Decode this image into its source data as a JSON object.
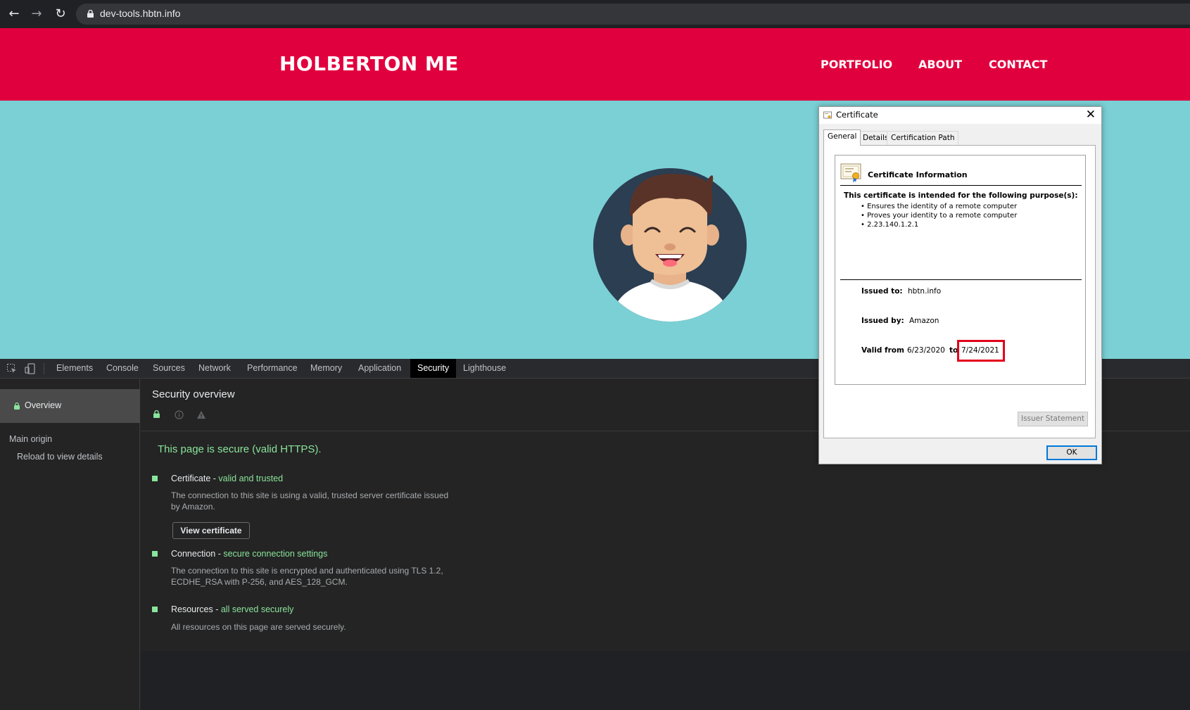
{
  "browser": {
    "url": "dev-tools.hbtn.info",
    "back_icon": "←",
    "forward_icon": "→",
    "reload_icon": "↻"
  },
  "site": {
    "title": "HOLBERTON ME",
    "nav": [
      "PORTFOLIO",
      "ABOUT",
      "CONTACT"
    ],
    "header_color": "#e1003e",
    "hero_color": "#7ad0d5"
  },
  "devtools": {
    "tabs": [
      "Elements",
      "Console",
      "Sources",
      "Network",
      "Performance",
      "Memory",
      "Application",
      "Security",
      "Lighthouse"
    ],
    "active_tab": "Security",
    "sidebar": {
      "overview": "Overview",
      "main_origin": "Main origin",
      "reload": "Reload to view details"
    },
    "overview_title": "Security overview",
    "secure_message": "This page is secure (valid HTTPS).",
    "items": [
      {
        "title": "Certificate",
        "status": "valid and trusted",
        "description": "The connection to this site is using a valid, trusted server certificate issued by Amazon."
      },
      {
        "title": "Connection",
        "status": "secure connection settings",
        "description": "The connection to this site is encrypted and authenticated using TLS 1.2, ECDHE_RSA with P-256, and AES_128_GCM."
      },
      {
        "title": "Resources",
        "status": "all served securely",
        "description": "All resources on this page are served securely."
      }
    ],
    "view_certificate_label": "View certificate",
    "accent_color": "#8ae49b"
  },
  "certificate_dialog": {
    "title": "Certificate",
    "close": "✕",
    "tabs": [
      "General",
      "Details",
      "Certification Path"
    ],
    "active_tab": "General",
    "info_heading": "Certificate Information",
    "purpose_heading": "This certificate is intended for the following purpose(s):",
    "purposes": [
      "• Ensures the identity of a remote computer",
      "• Proves your identity to a remote computer",
      "• 2.23.140.1.2.1"
    ],
    "issued_to_label": "Issued to:",
    "issued_to": "hbtn.info",
    "issued_by_label": "Issued by:",
    "issued_by": "Amazon",
    "valid_from_label": "Valid from",
    "valid_from": "6/23/2020",
    "to_label": "to",
    "valid_to": "7/24/2021",
    "issuer_statement_label": "Issuer Statement",
    "ok_label": "OK",
    "highlight_color": "#e3001b"
  }
}
